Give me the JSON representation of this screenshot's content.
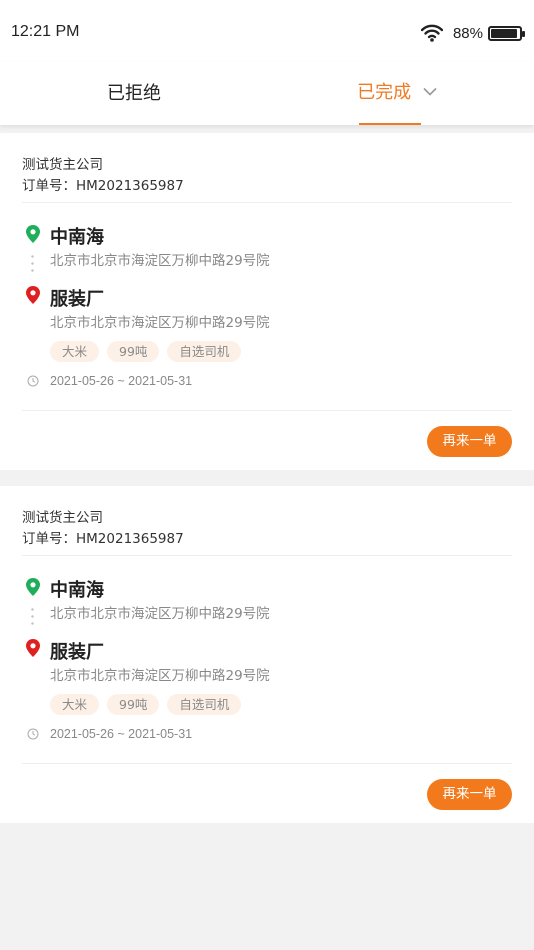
{
  "status_bar": {
    "time": "12:21 PM",
    "battery": "88%",
    "battery_level": 0.88
  },
  "tabs": [
    {
      "label": "已拒绝",
      "active": false
    },
    {
      "label": "已完成",
      "active": true
    }
  ],
  "colors": {
    "accent": "#f07a23",
    "start_pin": "#1fae5a",
    "end_pin": "#e02020",
    "tag_bg": "#fdf0e6"
  },
  "orders": [
    {
      "company": "测试货主公司",
      "order_label": "订单号：",
      "order_no": "HM2021365987",
      "start": {
        "name": "中南海",
        "address": "北京市北京市海淀区万柳中路29号院"
      },
      "end": {
        "name": "服装厂",
        "address": "北京市北京市海淀区万柳中路29号院"
      },
      "tags": [
        "大米",
        "99吨",
        "自选司机"
      ],
      "dates": "2021-05-26 ~ 2021-05-31",
      "action_label": "再来一单"
    },
    {
      "company": "测试货主公司",
      "order_label": "订单号：",
      "order_no": "HM2021365987",
      "start": {
        "name": "中南海",
        "address": "北京市北京市海淀区万柳中路29号院"
      },
      "end": {
        "name": "服装厂",
        "address": "北京市北京市海淀区万柳中路29号院"
      },
      "tags": [
        "大米",
        "99吨",
        "自选司机"
      ],
      "dates": "2021-05-26 ~ 2021-05-31",
      "action_label": "再来一单"
    }
  ]
}
